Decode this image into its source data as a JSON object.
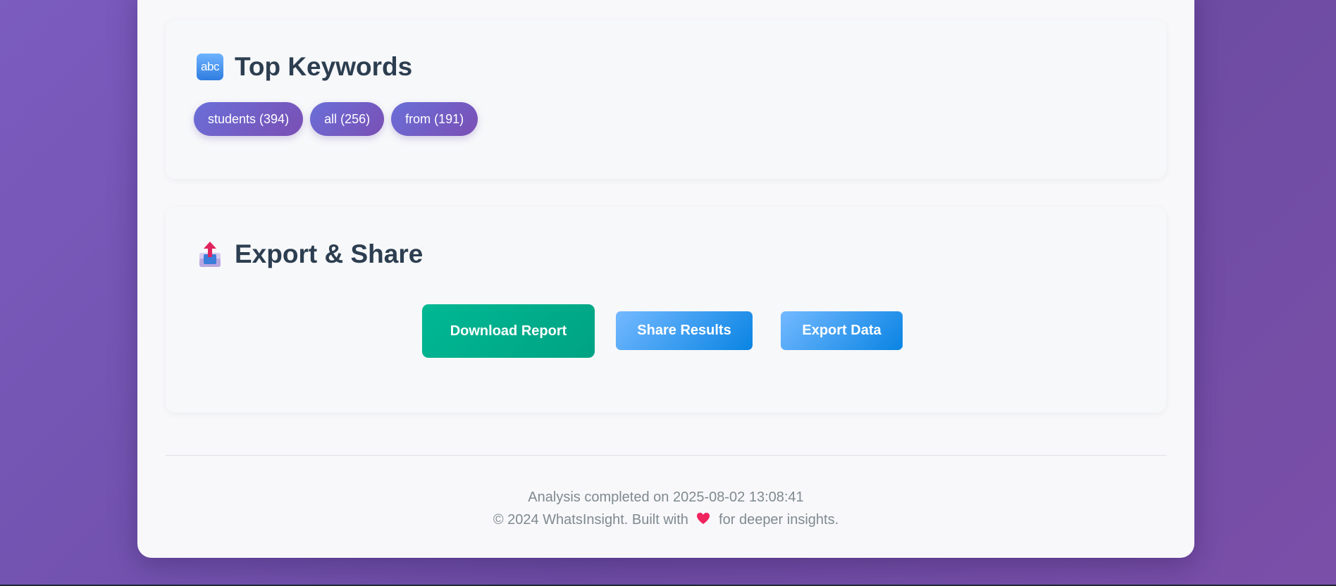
{
  "keywords_section": {
    "title": "Top Keywords",
    "icon": "abc-input-icon",
    "icon_text": "abc",
    "tags": [
      {
        "label": "students (394)"
      },
      {
        "label": "all (256)"
      },
      {
        "label": "from (191)"
      }
    ]
  },
  "export_section": {
    "title": "Export & Share",
    "icon": "outbox-tray-icon",
    "buttons": {
      "download": "Download Report",
      "share": "Share Results",
      "export": "Export Data"
    }
  },
  "footer": {
    "analysis_text": "Analysis completed on 2025-08-02 13:08:41",
    "copyright_prefix": "© 2024 WhatsInsight. Built with",
    "copyright_suffix": "for deeper insights.",
    "heart_icon": "red-heart-icon"
  },
  "colors": {
    "accent_purple": "#6a6fd8",
    "download_green": "#00b894",
    "share_blue": "#0984e3",
    "heading": "#2c3e50"
  }
}
